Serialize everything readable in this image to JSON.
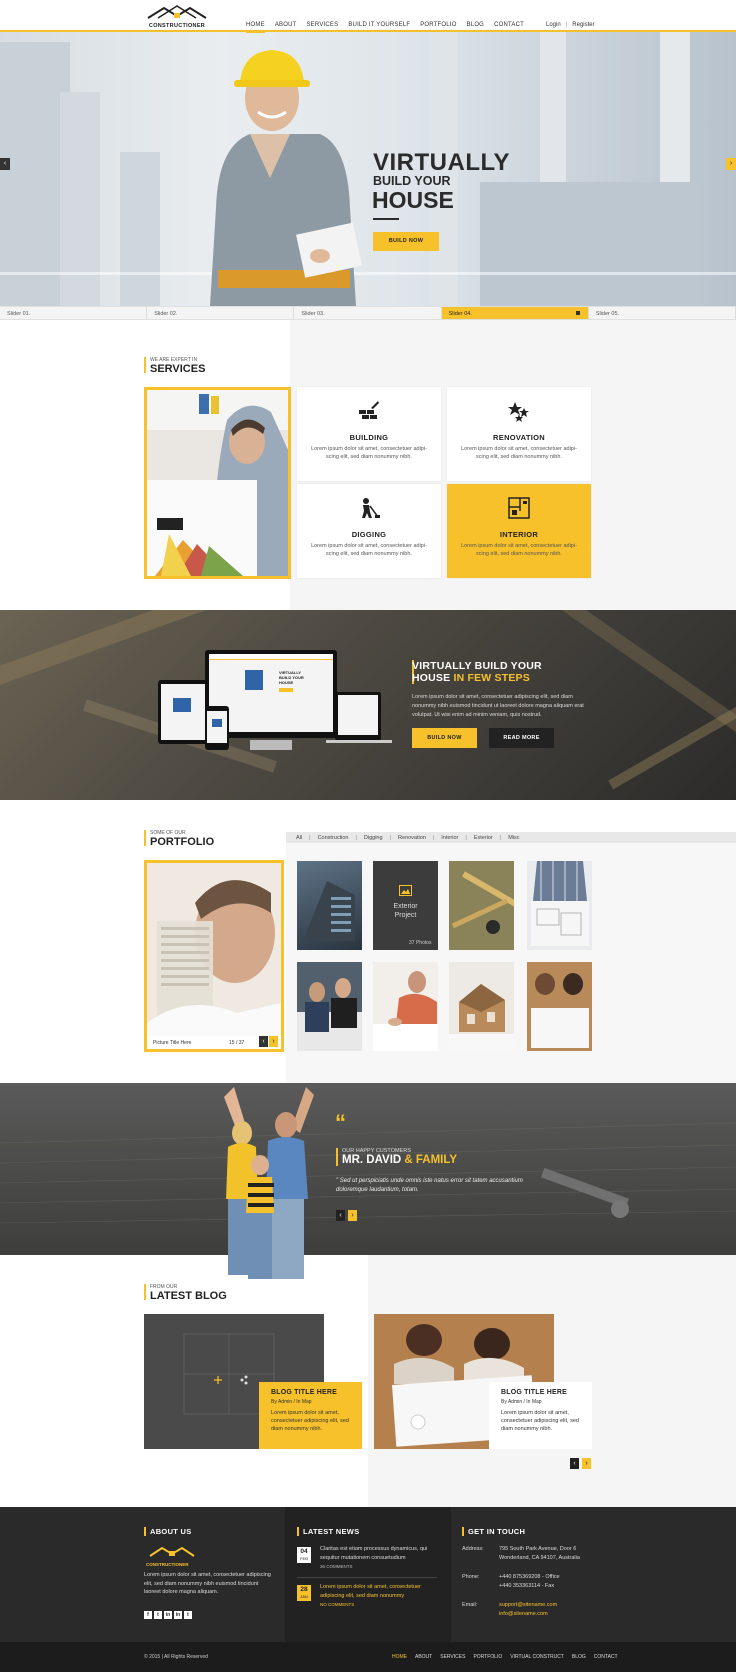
{
  "brand": {
    "name": "CONSTRUCTIONER",
    "accent": "#f7c12b",
    "dark": "#222222"
  },
  "nav": {
    "items": [
      "HOME",
      "ABOUT",
      "SERVICES",
      "BUILD IT YOURSELF",
      "PORTFOLIO",
      "BLOG",
      "CONTACT"
    ],
    "active": "HOME"
  },
  "auth": {
    "login": "Login",
    "separator": "|",
    "register": "Register"
  },
  "hero": {
    "line1": "VIRTUALLY",
    "line2": "BUILD YOUR",
    "line3": "HOUSE",
    "button": "BUILD NOW",
    "prev_icon": "chevron-left-icon",
    "next_icon": "chevron-right-icon"
  },
  "slider_tabs": [
    {
      "label": "Slider 01."
    },
    {
      "label": "Slider 02."
    },
    {
      "label": "Slider 03."
    },
    {
      "label": "Slider 04.",
      "active": true
    },
    {
      "label": "Slider 05."
    }
  ],
  "services": {
    "eyebrow": "WE ARE EXPERT IN",
    "title": "SERVICES",
    "cards": [
      {
        "title": "BUILDING",
        "text": "Lorem ipsum dolor sit amet, consectetuer adipi-scing elit, sed diam nonummy nibh.",
        "icon": "bricks-trowel-icon"
      },
      {
        "title": "RENOVATION",
        "text": "Lorem ipsum dolor sit amet, consectetuer adipi-scing elit, sed diam nonummy nibh.",
        "icon": "stars-icon"
      },
      {
        "title": "DIGGING",
        "text": "Lorem ipsum dolor sit amet, consectetuer adipi-scing elit, sed diam nonummy nibh.",
        "icon": "worker-digging-icon"
      },
      {
        "title": "INTERIOR",
        "text": "Lorem ipsum dolor sit amet, consectetuer adipi-scing elit, sed diam nonummy nibh.",
        "icon": "floor-plan-icon"
      }
    ]
  },
  "banner": {
    "title_line1": "VIRTUALLY BUILD YOUR",
    "title_line2_white": "HOUSE",
    "title_line2_yellow": "IN FEW STEPS",
    "text": "Lorem ipsum dolor sit amet, consectetuer adipiscing elit, sed diam nonummy nibh euismod tincidunt ut laoreet dolore magna aliquam erat volutpat. Ut wisi enim ad minim veniam, quis nostrud.",
    "btn_primary": "BUILD NOW",
    "btn_secondary": "READ MORE",
    "screen_title1": "VIRTUALLY",
    "screen_title2": "BUILD YOUR",
    "screen_title3": "HOUSE"
  },
  "portfolio": {
    "eyebrow": "SOME OF OUR",
    "title": "PORTFOLIO",
    "filters": [
      "All",
      "Construction",
      "Digging",
      "Renovation",
      "Interior",
      "Exterior",
      "Misc"
    ],
    "featured_caption": "Picture Title Here",
    "featured_counter": "15 / 37",
    "overlay_title": "Exterior Project",
    "overlay_count": "37 Photos"
  },
  "testimonial": {
    "eyebrow": "OUR HAPPY CUSTOMERS",
    "name_white": "MR. DAVID",
    "name_yellow": "& FAMILY",
    "quote": "\" Sed ut perspiciatis unde omnis iste natus error sit tatem accusantium doloremque laudantium, totam."
  },
  "blog": {
    "eyebrow": "FROM OUR",
    "title": "LATEST BLOG",
    "posts": [
      {
        "title": "BLOG TITLE HERE",
        "meta": "By Admin   /   In Map",
        "text": "Lorem ipsum dolor sit amet, consectetuer adipiscing elit, sed diam nonummy nibh."
      },
      {
        "title": "BLOG TITLE HERE",
        "meta": "By Admin   /   In Map",
        "text": "Lorem ipsum dolor sit amet, consectetuer adipiscing elit, sed diam nonummy nibh."
      }
    ]
  },
  "footer": {
    "about": {
      "title": "ABOUT US",
      "text": "Lorem ipsum dolor sit amet, consectetuer adipiscing elit, sed diam nonummy nibh euismod tincidunt laoreet dolore magna aliquam.",
      "social": [
        "f",
        "t",
        "in",
        "in",
        "t"
      ]
    },
    "news": {
      "title": "LATEST NEWS",
      "items": [
        {
          "day": "04",
          "month": "FEB",
          "text": "Claritas est etiam processus dynamicus, qui sequitur mutationem consuetudium",
          "comments": "36 COMMENTS"
        },
        {
          "day": "28",
          "month": "JAN",
          "text": "Lorem ipsum dolor sit amet, consectetuer adipiscing elit, sed diam nonummy",
          "comments": "NO COMMENTS"
        }
      ]
    },
    "contact": {
      "title": "GET IN TOUCH",
      "address_label": "Address:",
      "address": "795 South Park Avenue, Door 6 Wonderland, CA 94107, Australia",
      "phone_label": "Phone:",
      "phone1": "+440 875369208 - Office",
      "phone2": "+440 353363114 - Fax",
      "email_label": "Email:",
      "email1": "support@sitename.com",
      "email2": "info@sitename.com"
    },
    "copyright": "© 2015  |  All Rights Reserved",
    "nav": [
      "HOME",
      "ABOUT",
      "SERVICES",
      "PORTFOLIO",
      "VIRTUAL CONSTRUCT",
      "BLOG",
      "CONTACT"
    ]
  }
}
